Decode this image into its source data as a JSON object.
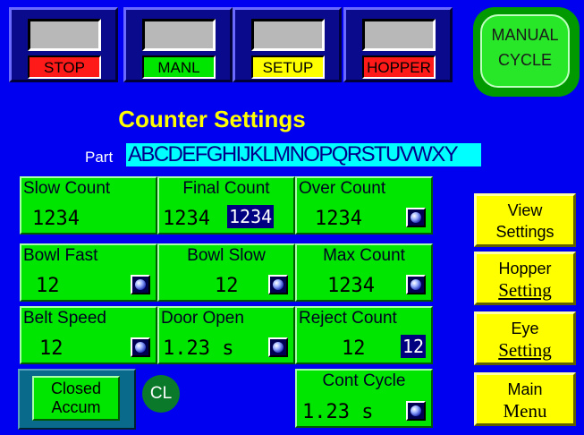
{
  "status_modes": [
    {
      "label": "STOP",
      "color": "#ff1a1a"
    },
    {
      "label": "MANL",
      "color": "#00e600"
    },
    {
      "label": "SETUP",
      "color": "#ffff00"
    },
    {
      "label": "HOPPER",
      "color": "#ff1a1a"
    }
  ],
  "manual_cycle": {
    "line1": "MANUAL",
    "line2": "CYCLE"
  },
  "title": "Counter Settings",
  "part": {
    "label": "Part",
    "value": "ABCDEFGHIJKLMNOPQRSTUVWXY"
  },
  "cells": {
    "slow_count": {
      "label": "Slow Count",
      "value": "1234"
    },
    "final_count": {
      "label": "Final Count",
      "value": "1234",
      "value_alt": "1234"
    },
    "over_count": {
      "label": "Over Count",
      "value": "1234"
    },
    "bowl_fast": {
      "label": "Bowl Fast",
      "value": "12"
    },
    "bowl_slow": {
      "label": "Bowl Slow",
      "value": "12"
    },
    "max_count": {
      "label": "Max Count",
      "value": "1234"
    },
    "belt_speed": {
      "label": "Belt Speed",
      "value": "12"
    },
    "door_open": {
      "label": "Door Open",
      "value": "1.23 s"
    },
    "reject_count": {
      "label": "Reject Count",
      "value": "12",
      "value_alt": "12"
    },
    "cont_cycle": {
      "label": "Cont Cycle",
      "value": "1.23 s"
    }
  },
  "side_buttons": {
    "view_settings": {
      "line1": "View",
      "line2": "Settings"
    },
    "hopper_setting": {
      "line1": "Hopper",
      "line2": "Setting"
    },
    "eye_setting": {
      "line1": "Eye",
      "line2": "Setting"
    },
    "main_menu": {
      "line1": "Main",
      "line2": "Menu"
    }
  },
  "closed_accum": {
    "line1": "Closed",
    "line2": "Accum"
  },
  "cl_indicator": "CL",
  "icons": {
    "knob": "knob-icon"
  }
}
